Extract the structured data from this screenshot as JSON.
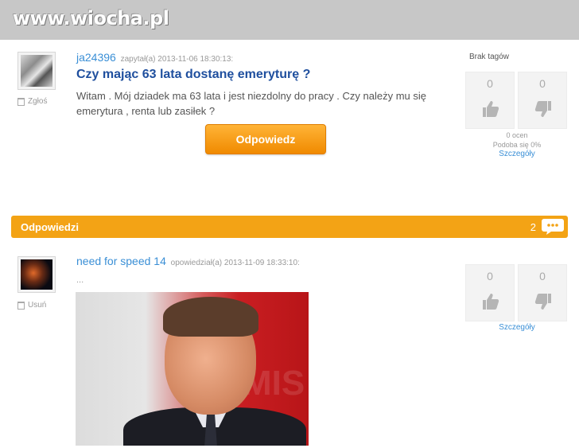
{
  "site": {
    "logo_text": "www.wiocha.pl"
  },
  "question": {
    "username": "ja24396",
    "meta": "zapytał(a) 2013-11-06 18:30:13:",
    "report_label": "Zgłoś",
    "title": "Czy mając 63 lata dostanę emeryturę ?",
    "body": "Witam . Mój dziadek ma 63 lata i jest niezdolny do pracy . Czy należy mu się emerytura , renta lub zasiłek ?",
    "answer_button": "Odpowiedz",
    "tags_label": "Brak tagów",
    "votes": {
      "up": "0",
      "down": "0"
    },
    "ratings_count": "0 ocen",
    "liked_percent": "Podoba się 0%",
    "details_link": "Szczegóły"
  },
  "answers_section": {
    "label": "Odpowiedzi",
    "count": "2"
  },
  "answer": {
    "username": "need for speed 14",
    "meta": "opowiedział(a) 2013-11-09 18:33:10:",
    "delete_label": "Usuń",
    "body": "...",
    "image_watermark": "MIS",
    "votes": {
      "up": "0",
      "down": "0"
    },
    "details_link": "Szczegóły"
  },
  "colors": {
    "accent_orange": "#f3a315",
    "link_blue": "#3a8fd6",
    "title_blue": "#1f4f9e",
    "topbar_gray": "#c7c7c7"
  }
}
